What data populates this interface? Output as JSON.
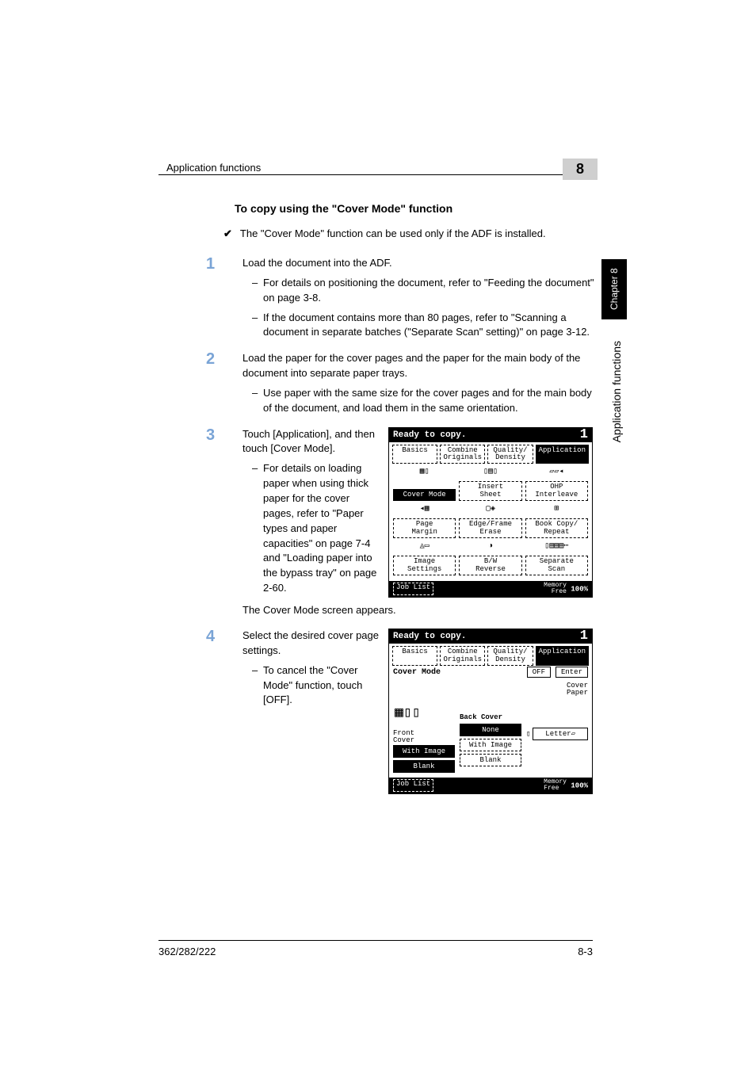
{
  "header": {
    "section_title": "Application functions",
    "chapter_num": "8"
  },
  "side_tab": "Chapter 8",
  "side_title": "Application functions",
  "heading": "To copy using the \"Cover Mode\" function",
  "check_note": "The \"Cover Mode\" function can be used only if the ADF is installed.",
  "steps": {
    "s1": {
      "num": "1",
      "text": "Load the document into the ADF.",
      "subs": [
        "For details on positioning the document, refer to \"Feeding the document\" on page 3-8.",
        "If the document contains more than 80 pages, refer to \"Scanning a document in separate batches (\"Separate Scan\" setting)\" on page 3-12."
      ]
    },
    "s2": {
      "num": "2",
      "text": "Load the paper for the cover pages and the paper for the main body of the document into separate paper trays.",
      "subs": [
        "Use paper with the same size for the cover pages and for the main body of the document, and load them in the same orientation."
      ]
    },
    "s3": {
      "num": "3",
      "text": "Touch [Application], and then touch [Cover Mode].",
      "subs": [
        "For details on loading paper when using thick paper for the cover pages, refer to \"Paper types and paper capacities\" on page 7-4 and \"Loading paper into the bypass tray\" on page 2-60."
      ],
      "after": "The Cover Mode screen appears."
    },
    "s4": {
      "num": "4",
      "text": "Select the desired cover page settings.",
      "subs": [
        "To cancel the \"Cover Mode\" function, touch [OFF]."
      ]
    }
  },
  "lcd1": {
    "ready": "Ready to copy.",
    "count": "1",
    "tabs": {
      "basics": "Basics",
      "combine": "Combine\nOriginals",
      "quality": "Quality/\nDensity",
      "application": "Application"
    },
    "row1": {
      "cover_mode": "Cover Mode",
      "insert": "Insert\nSheet",
      "ohp": "OHP\nInterleave"
    },
    "row2": {
      "page_margin": "Page\nMargin",
      "edge": "Edge/Frame\nErase",
      "book": "Book Copy/\nRepeat"
    },
    "row3": {
      "image": "Image\nSettings",
      "bv": "B/W\nReverse",
      "separate": "Separate\nScan"
    },
    "footer": {
      "job": "Job List",
      "mem": "Memory\nFree",
      "pct": "100%"
    }
  },
  "lcd2": {
    "ready": "Ready to copy.",
    "count": "1",
    "tabs": {
      "basics": "Basics",
      "combine": "Combine\nOriginals",
      "quality": "Quality/\nDensity",
      "application": "Application"
    },
    "mode_label": "Cover Mode",
    "off": "OFF",
    "enter": "Enter",
    "cover_paper": "Cover\nPaper",
    "back_cover": "Back Cover",
    "front_cover": "Front\nCover",
    "none": "None",
    "with_image": "With Image",
    "blank": "Blank",
    "letter": "Letter",
    "footer": {
      "job": "Job List",
      "mem": "Memory\nFree",
      "pct": "100%"
    }
  },
  "footer": {
    "left": "362/282/222",
    "right": "8-3"
  }
}
